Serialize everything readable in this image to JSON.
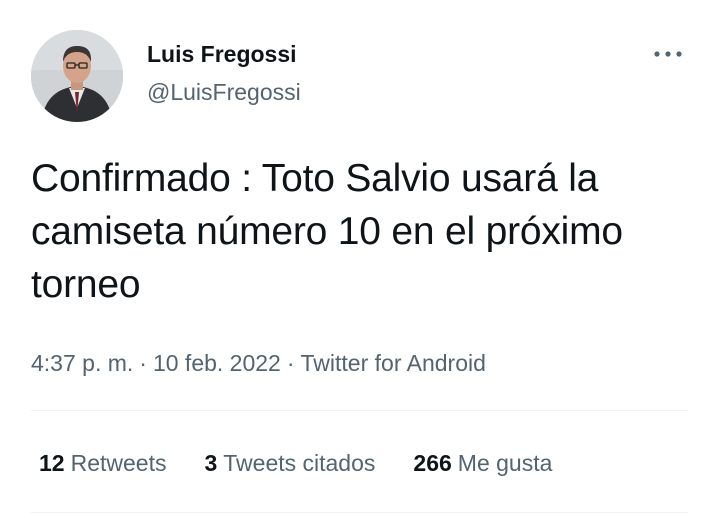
{
  "author": {
    "name": "Luis Fregossi",
    "handle": "@LuisFregossi"
  },
  "tweet": {
    "text": "Confirmado : Toto Salvio usará la camiseta número 10 en el próximo torneo"
  },
  "meta": {
    "time": "4:37 p. m.",
    "date": "10 feb. 2022",
    "separator": "·",
    "source": "Twitter for Android"
  },
  "stats": {
    "retweets": {
      "count": "12",
      "label": "Retweets"
    },
    "quotes": {
      "count": "3",
      "label": "Tweets citados"
    },
    "likes": {
      "count": "266",
      "label": "Me gusta"
    }
  },
  "icons": {
    "more": "more-horizontal-icon"
  },
  "colors": {
    "text_primary": "#0f1419",
    "text_secondary": "#536471",
    "divider": "#eff3f4"
  }
}
